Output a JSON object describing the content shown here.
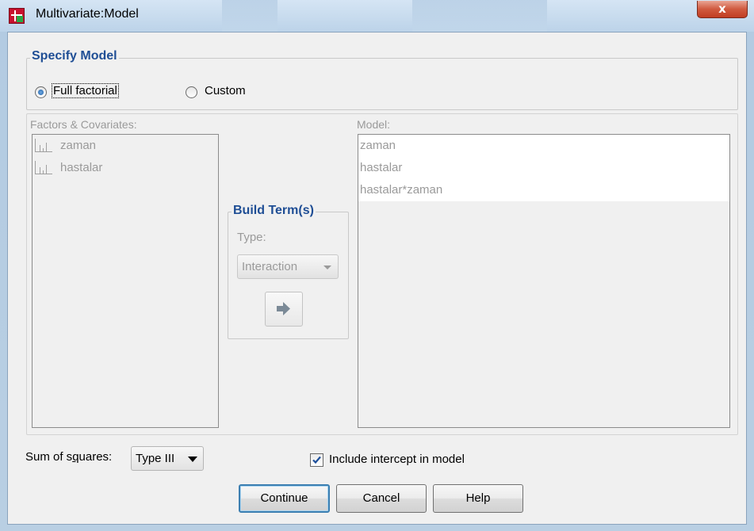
{
  "window": {
    "title": "Multivariate:Model",
    "close_glyph": "x",
    "icon": "spss-dialog-icon"
  },
  "specify_model": {
    "title": "Specify Model",
    "full_factorial": {
      "label": "Full factorial",
      "selected": true
    },
    "custom": {
      "label": "Custom",
      "selected": false
    }
  },
  "factors": {
    "label": "Factors & Covariates:",
    "items": [
      "zaman",
      "hastalar"
    ],
    "item_icon": "scale-variable-icon"
  },
  "build_terms": {
    "title": "Build Term(s)",
    "type_label": "Type:",
    "type_value": "Interaction",
    "move_icon": "arrow-right-icon"
  },
  "model": {
    "label": "Model:",
    "items": [
      "zaman",
      "hastalar",
      "hastalar*zaman"
    ]
  },
  "sum_of_squares": {
    "label": "Sum of squares:",
    "value": "Type III"
  },
  "intercept": {
    "label": "Include intercept in model",
    "checked": true
  },
  "buttons": {
    "continue": "Continue",
    "cancel": "Cancel",
    "help": "Help"
  },
  "colors": {
    "group_title": "#1f4e95",
    "disabled_text": "#9a9a9a",
    "close_button": "#c94a2e"
  }
}
